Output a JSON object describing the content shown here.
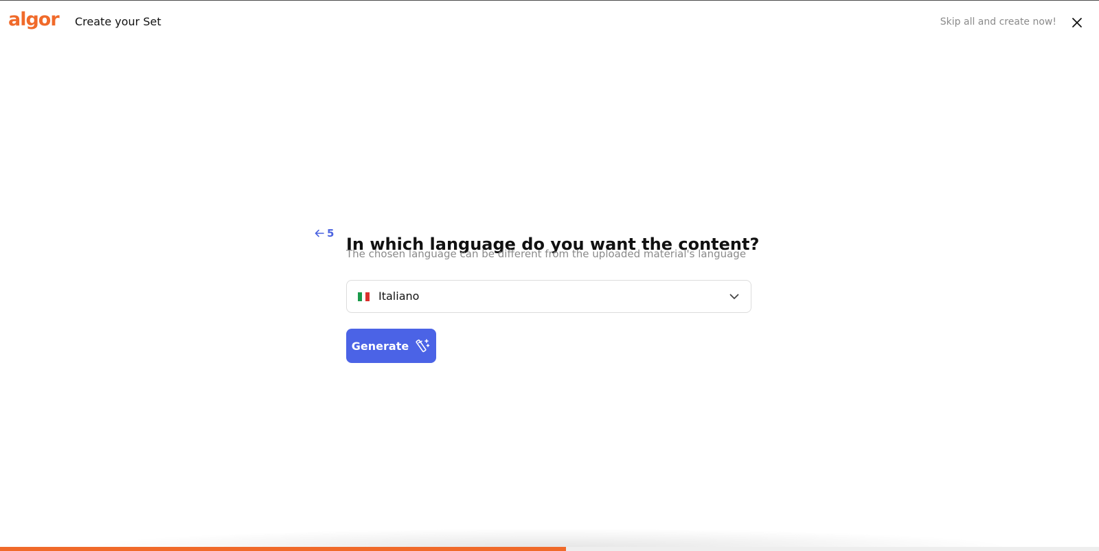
{
  "header": {
    "logo_text": "algor",
    "title": "Create your Set",
    "skip_label": "Skip all and create now!",
    "close_icon": "close-icon"
  },
  "step": {
    "number": "5",
    "back_icon": "arrow-left-icon",
    "question": "In which language do you want the content?",
    "subtitle": "The chosen language can be different from the uploaded material's language"
  },
  "language_select": {
    "selected_value": "Italiano",
    "flag_icon": "italy-flag-icon",
    "chevron_icon": "chevron-down-icon",
    "flag_colors": [
      "#1a9a4a",
      "#ffffff",
      "#d9302c"
    ]
  },
  "generate_button": {
    "label": "Generate",
    "icon": "magic-wand-sparkle-icon"
  },
  "progress": {
    "fraction": 0.515
  },
  "colors": {
    "brand_orange": "#f06a2a",
    "primary_blue": "#4b63e6",
    "muted_text": "#8a8a8a",
    "border": "#dcdcdc"
  }
}
